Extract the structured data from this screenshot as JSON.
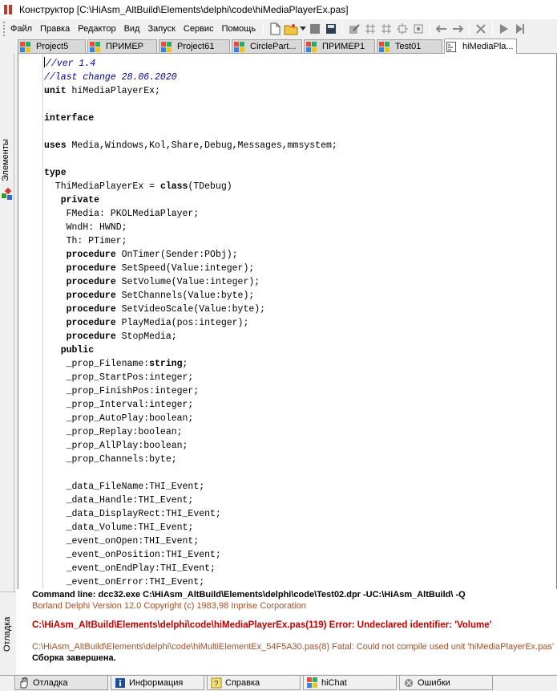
{
  "window": {
    "title": "Конструктор [C:\\HiAsm_AltBuild\\Elements\\delphi\\code\\hiMediaPlayerEx.pas]"
  },
  "menu": [
    "Файл",
    "Правка",
    "Редактор",
    "Вид",
    "Запуск",
    "Сервис",
    "Помощь"
  ],
  "toolbar": {
    "icons": [
      "new-file-icon",
      "open-folder-icon",
      "dropdown-arrow-icon",
      "stop-icon",
      "save-icon",
      "edit-icon",
      "grid-icon",
      "grid-icon",
      "align-icon",
      "fit-icon",
      "back-arrow-icon",
      "forward-arrow-icon",
      "delete-icon",
      "run-icon",
      "step-icon"
    ]
  },
  "tabs": [
    {
      "label": "Project5",
      "icon": "delphi-icon",
      "active": false
    },
    {
      "label": "ПРИМЕР",
      "icon": "delphi-icon",
      "active": false
    },
    {
      "label": "Project61",
      "icon": "delphi-icon",
      "active": false
    },
    {
      "label": "CirclePart...",
      "icon": "delphi-icon",
      "active": false
    },
    {
      "label": "ПРИМЕР1",
      "icon": "delphi-icon",
      "active": false
    },
    {
      "label": "Test01",
      "icon": "delphi-icon",
      "active": false
    },
    {
      "label": "hiMediaPla...",
      "icon": "code-file-icon",
      "active": true
    }
  ],
  "left_panel": {
    "label": "Элементы"
  },
  "editor": {
    "lines": [
      [
        {
          "t": "//ver 1.4",
          "c": "cmt"
        }
      ],
      [
        {
          "t": "//last change 28.06.2020",
          "c": "cmt"
        }
      ],
      [
        {
          "t": "unit ",
          "c": "kw"
        },
        {
          "t": "hiMediaPlayerEx;",
          "c": ""
        }
      ],
      [],
      [
        {
          "t": "interface",
          "c": "kw"
        }
      ],
      [],
      [
        {
          "t": "uses ",
          "c": "kw"
        },
        {
          "t": "Media,Windows,Kol,Share,Debug,Messages,mmsystem;",
          "c": ""
        }
      ],
      [],
      [
        {
          "t": "type",
          "c": "kw"
        }
      ],
      [
        {
          "t": "  ThiMediaPlayerEx = ",
          "c": ""
        },
        {
          "t": "class",
          "c": "kw"
        },
        {
          "t": "(TDebug)",
          "c": ""
        }
      ],
      [
        {
          "t": "   ",
          "c": ""
        },
        {
          "t": "private",
          "c": "kw"
        }
      ],
      [
        {
          "t": "    FMedia: PKOLMediaPlayer;",
          "c": ""
        }
      ],
      [
        {
          "t": "    WndH: HWND;",
          "c": ""
        }
      ],
      [
        {
          "t": "    Th: PTimer;",
          "c": ""
        }
      ],
      [
        {
          "t": "    ",
          "c": ""
        },
        {
          "t": "procedure",
          "c": "kw"
        },
        {
          "t": " OnTimer(Sender:PObj);",
          "c": ""
        }
      ],
      [
        {
          "t": "    ",
          "c": ""
        },
        {
          "t": "procedure",
          "c": "kw"
        },
        {
          "t": " SetSpeed(Value:integer);",
          "c": ""
        }
      ],
      [
        {
          "t": "    ",
          "c": ""
        },
        {
          "t": "procedure",
          "c": "kw"
        },
        {
          "t": " SetVolume(Value:integer);",
          "c": ""
        }
      ],
      [
        {
          "t": "    ",
          "c": ""
        },
        {
          "t": "procedure",
          "c": "kw"
        },
        {
          "t": " SetChannels(Value:byte);",
          "c": ""
        }
      ],
      [
        {
          "t": "    ",
          "c": ""
        },
        {
          "t": "procedure",
          "c": "kw"
        },
        {
          "t": " SetVideoScale(Value:byte);",
          "c": ""
        }
      ],
      [
        {
          "t": "    ",
          "c": ""
        },
        {
          "t": "procedure",
          "c": "kw"
        },
        {
          "t": " PlayMedia(pos:integer);",
          "c": ""
        }
      ],
      [
        {
          "t": "    ",
          "c": ""
        },
        {
          "t": "procedure",
          "c": "kw"
        },
        {
          "t": " StopMedia;",
          "c": ""
        }
      ],
      [
        {
          "t": "   ",
          "c": ""
        },
        {
          "t": "public",
          "c": "kw"
        }
      ],
      [
        {
          "t": "    _prop_Filename:",
          "c": ""
        },
        {
          "t": "string",
          "c": "kw"
        },
        {
          "t": ";",
          "c": ""
        }
      ],
      [
        {
          "t": "    _prop_StartPos:integer;",
          "c": ""
        }
      ],
      [
        {
          "t": "    _prop_FinishPos:integer;",
          "c": ""
        }
      ],
      [
        {
          "t": "    _prop_Interval:integer;",
          "c": ""
        }
      ],
      [
        {
          "t": "    _prop_AutoPlay:boolean;",
          "c": ""
        }
      ],
      [
        {
          "t": "    _prop_Replay:boolean;",
          "c": ""
        }
      ],
      [
        {
          "t": "    _prop_AllPlay:boolean;",
          "c": ""
        }
      ],
      [
        {
          "t": "    _prop_Channels:byte;",
          "c": ""
        }
      ],
      [],
      [
        {
          "t": "    _data_FileName:THI_Event;",
          "c": ""
        }
      ],
      [
        {
          "t": "    _data_Handle:THI_Event;",
          "c": ""
        }
      ],
      [
        {
          "t": "    _data_DisplayRect:THI_Event;",
          "c": ""
        }
      ],
      [
        {
          "t": "    _data_Volume:THI_Event;",
          "c": ""
        }
      ],
      [
        {
          "t": "    _event_onOpen:THI_Event;",
          "c": ""
        }
      ],
      [
        {
          "t": "    _event_onPosition:THI_Event;",
          "c": ""
        }
      ],
      [
        {
          "t": "    _event_onEndPlay:THI_Event;",
          "c": ""
        }
      ],
      [
        {
          "t": "    _event_onError:THI_Event;",
          "c": ""
        }
      ]
    ]
  },
  "output": {
    "label": "Отладка",
    "lines": [
      {
        "text": "Command line: dcc32.exe  C:\\HiAsm_AltBuild\\Elements\\delphi\\code\\Test02.dpr  -UC:\\HiAsm_AltBuild\\  -Q",
        "kind": "cmd"
      },
      {
        "text": "Borland Delphi  Version 12.0  Copyright (c) 1983,98 Inprise Corporation",
        "kind": "info"
      },
      {
        "text": "",
        "kind": "blank"
      },
      {
        "text": "C:\\HiAsm_AltBuild\\Elements\\delphi\\code\\hiMediaPlayerEx.pas(119) Error: Undeclared identifier: 'Volume'",
        "kind": "error"
      },
      {
        "text": "",
        "kind": "blank"
      },
      {
        "text": "C:\\HiAsm_AltBuild\\Elements\\delphi\\code\\hiMultiElementEx_54F5A30.pas(8) Fatal: Could not compile used unit 'hiMediaPlayerEx.pas'",
        "kind": "fatal"
      },
      {
        "text": "Сборка завершена.",
        "kind": "done"
      }
    ]
  },
  "bottom_tabs": [
    {
      "label": "Отладка",
      "icon": "hand-icon",
      "active": true
    },
    {
      "label": "Информация",
      "icon": "info-icon",
      "active": false
    },
    {
      "label": "Справка",
      "icon": "help-icon",
      "active": false
    },
    {
      "label": "hiChat",
      "icon": "chat-icon",
      "active": false
    },
    {
      "label": "Ошибки",
      "icon": "errors-icon",
      "active": false
    }
  ]
}
